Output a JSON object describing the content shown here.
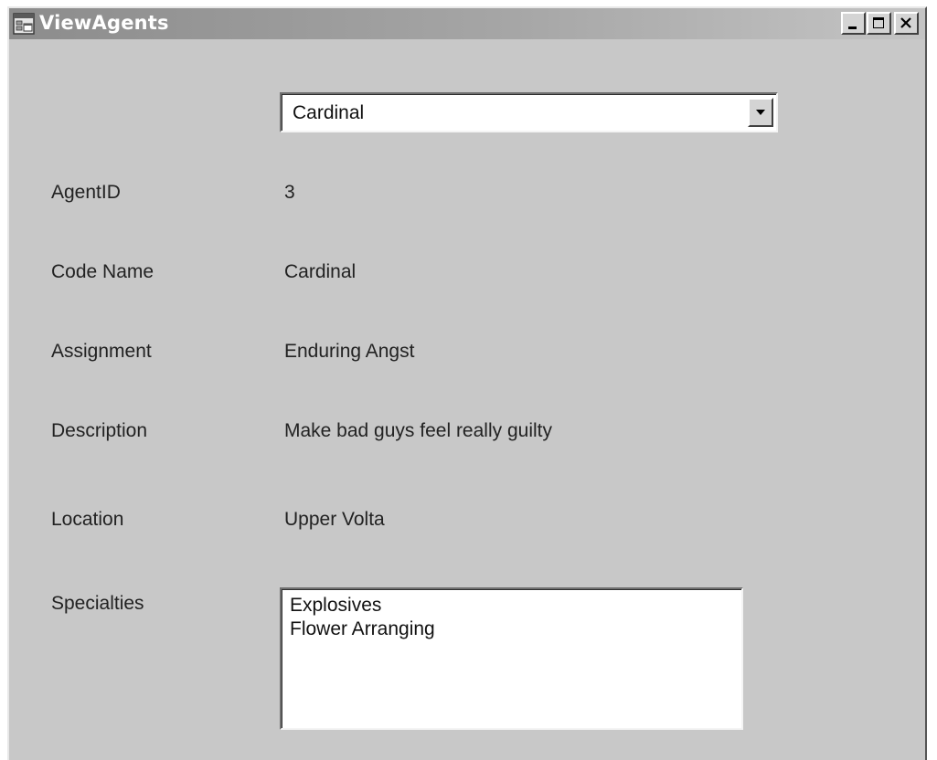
{
  "window": {
    "title": "ViewAgents",
    "app_icon": "window-app-icon",
    "controls": {
      "minimize_icon": "minimize-icon",
      "maximize_icon": "maximize-icon",
      "close_icon": "close-icon"
    }
  },
  "agent_selector": {
    "selected": "Cardinal",
    "dropdown_icon": "chevron-down-icon"
  },
  "fields": [
    {
      "label": "AgentID",
      "value": "3"
    },
    {
      "label": "Code Name",
      "value": "Cardinal"
    },
    {
      "label": "Assignment",
      "value": "Enduring Angst"
    },
    {
      "label": "Description",
      "value": "Make bad guys feel really guilty"
    },
    {
      "label": "Location",
      "value": "Upper Volta"
    }
  ],
  "specialties": {
    "label": "Specialties",
    "items": [
      "Explosives",
      "Flower Arranging"
    ]
  },
  "colors": {
    "window_face": "#c8c8c8",
    "titlebar_start": "#8c8c8c",
    "titlebar_end": "#c4c4c4",
    "title_text": "#ffffff"
  }
}
